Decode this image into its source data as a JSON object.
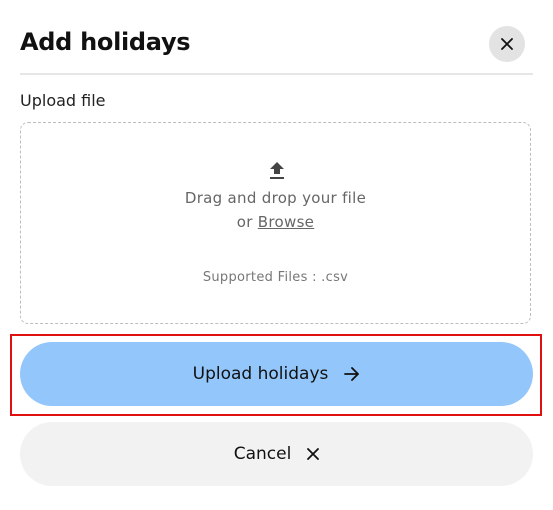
{
  "dialog": {
    "title": "Add holidays",
    "close_icon": "close-icon"
  },
  "upload": {
    "label": "Upload file",
    "icon": "upload-icon",
    "drag_text": "Drag and drop your file",
    "or_text": "or ",
    "browse_text": "Browse",
    "supported_text": "Supported Files : .csv"
  },
  "actions": {
    "upload_label": "Upload holidays",
    "upload_icon": "arrow-right-icon",
    "cancel_label": "Cancel",
    "cancel_icon": "close-icon"
  },
  "colors": {
    "primary_button": "#93c6fa",
    "secondary_button": "#f2f2f2",
    "highlight_border": "#e01010"
  }
}
